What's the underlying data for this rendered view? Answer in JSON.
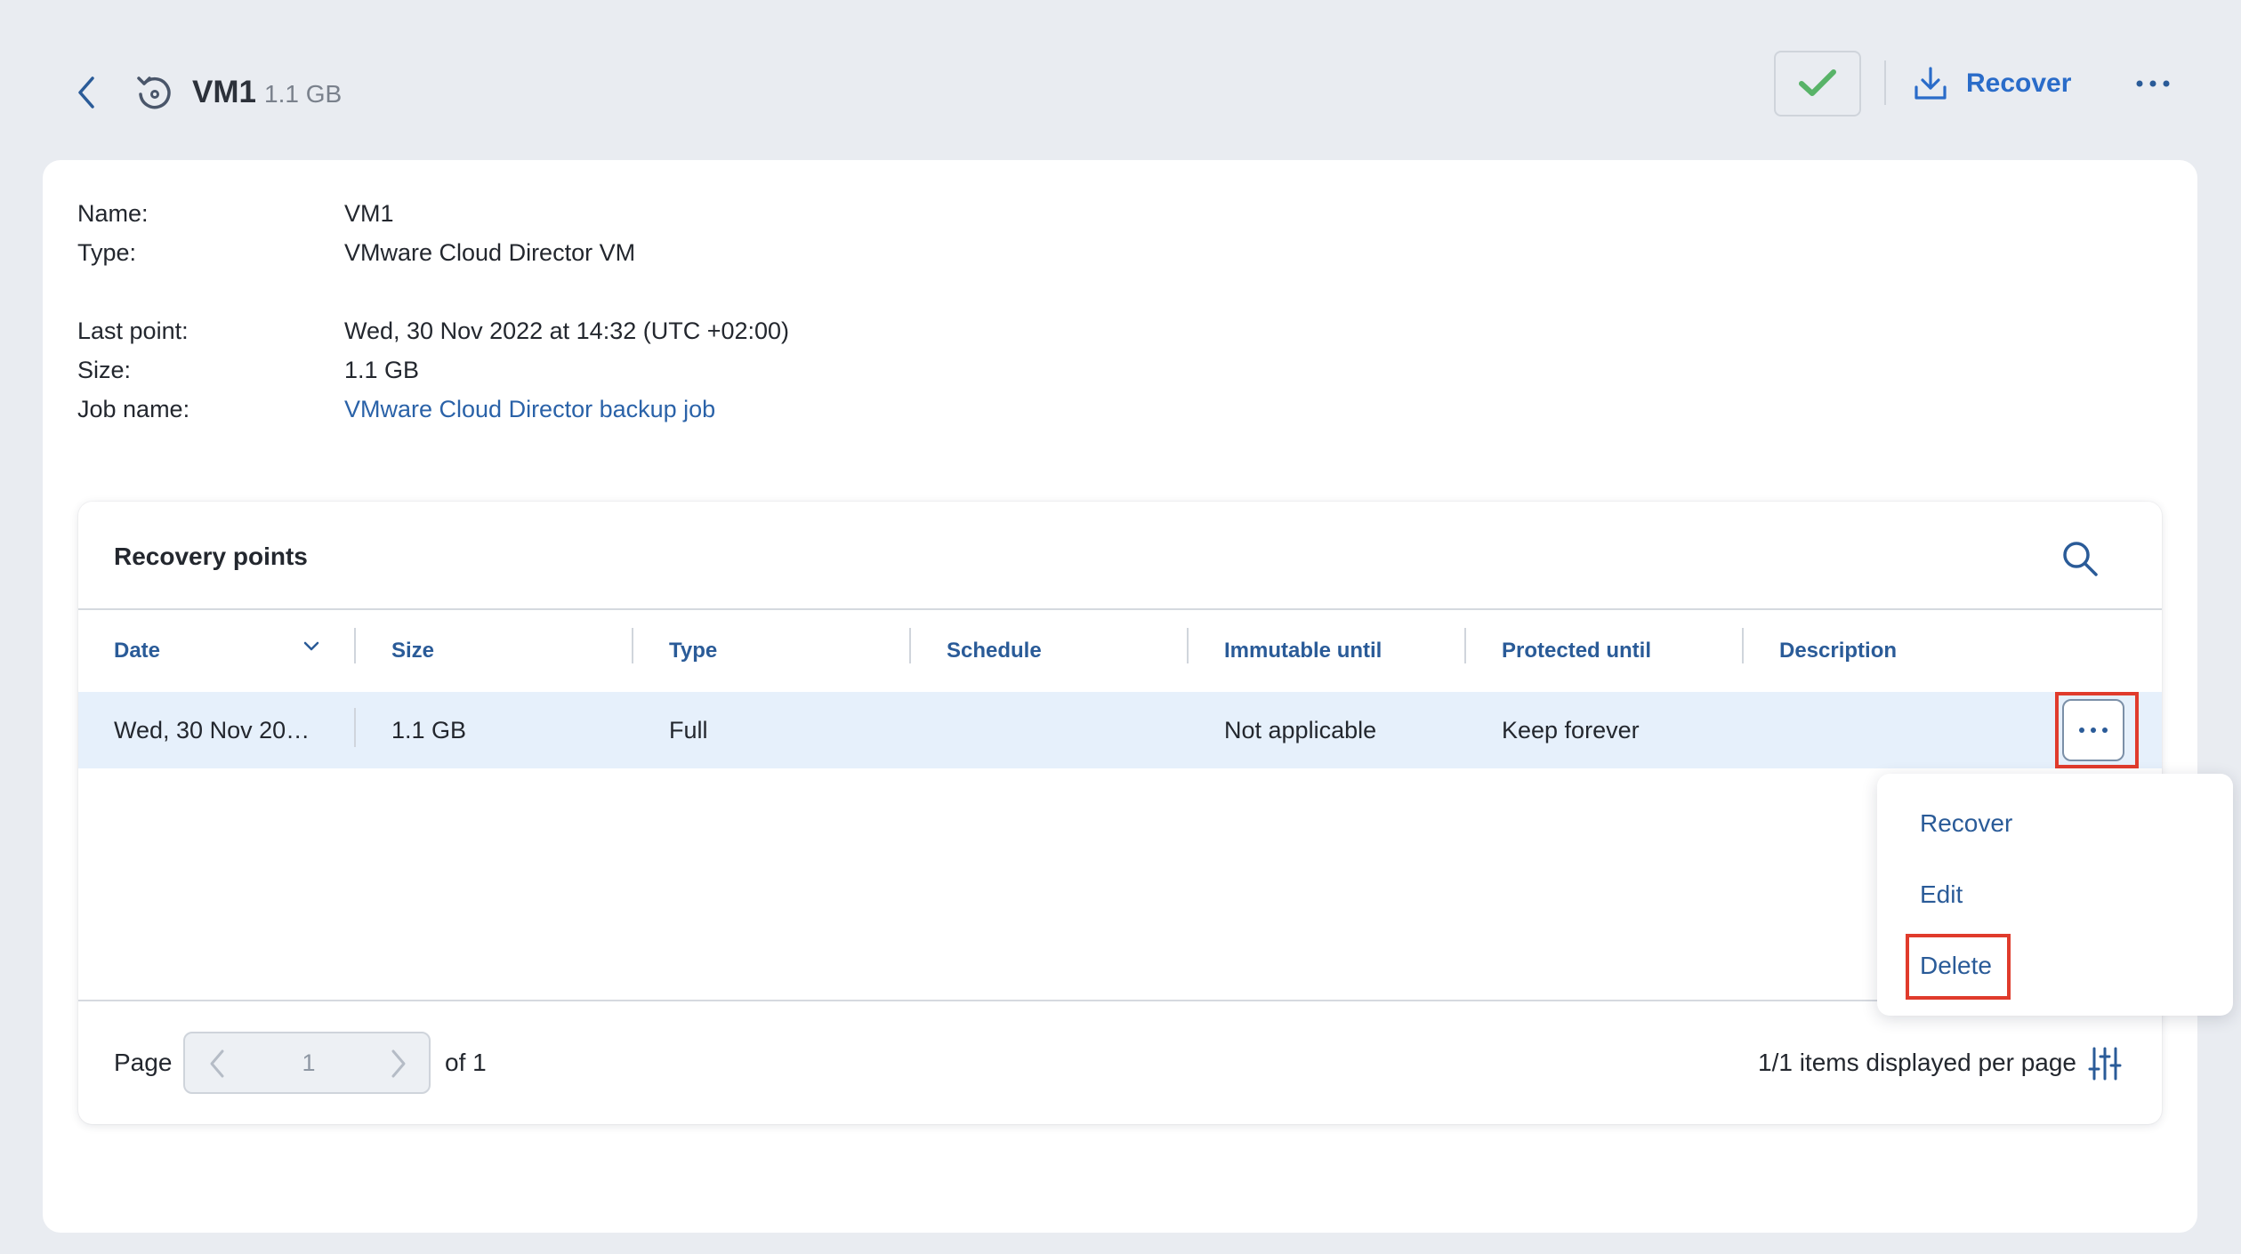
{
  "header": {
    "title": "VM1",
    "size": "1.1 GB",
    "recover_label": "Recover"
  },
  "info": {
    "name_label": "Name:",
    "name_value": "VM1",
    "type_label": "Type:",
    "type_value": "VMware Cloud Director VM",
    "last_point_label": "Last point:",
    "last_point_value": "Wed, 30 Nov 2022 at 14:32 (UTC +02:00)",
    "size_label": "Size:",
    "size_value": "1.1 GB",
    "job_label": "Job name:",
    "job_value": "VMware Cloud Director backup job"
  },
  "panel": {
    "title": "Recovery points",
    "columns": [
      "Date",
      "Size",
      "Type",
      "Schedule",
      "Immutable until",
      "Protected until",
      "Description"
    ],
    "rows": [
      {
        "date": "Wed, 30 Nov 20…",
        "size": "1.1 GB",
        "type": "Full",
        "schedule": "",
        "immutable": "Not applicable",
        "protected": "Keep forever",
        "description": ""
      }
    ]
  },
  "pagination": {
    "page_label": "Page",
    "current_page": "1",
    "of_label": "of 1",
    "per_page_label": "1/1 items displayed per page"
  },
  "menu": {
    "items": [
      "Recover",
      "Edit",
      "Delete"
    ]
  },
  "colors": {
    "accent": "#2a6cc9",
    "link": "#2a62a8",
    "check": "#58b368",
    "highlight": "#e03b2c",
    "row_selected": "#e6f0fb"
  },
  "icons": {
    "back": "chevron-left-icon",
    "vm": "restore-icon",
    "check": "check-icon",
    "recover": "download-icon",
    "more": "more-horizontal-icon",
    "search": "search-icon",
    "sort": "chevron-down-icon",
    "settings": "sliders-icon"
  }
}
